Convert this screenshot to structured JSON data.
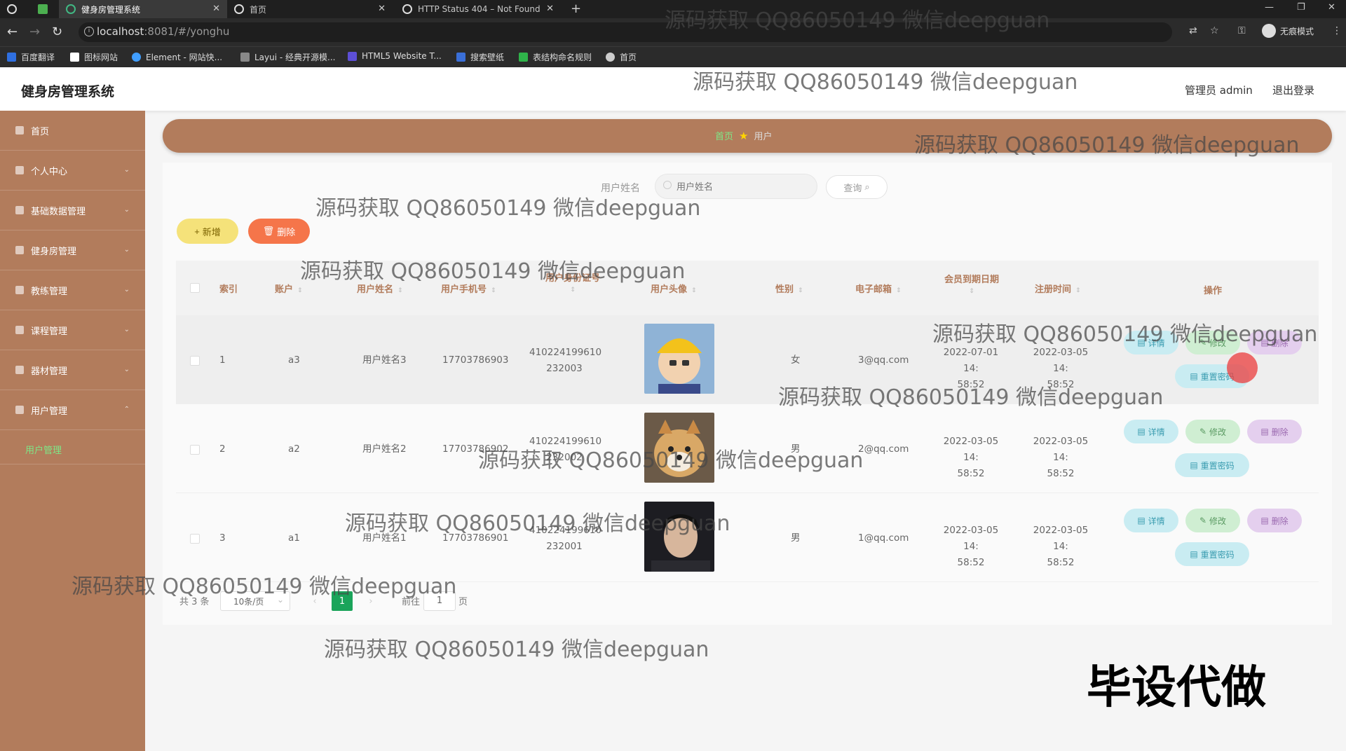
{
  "browser": {
    "tabs": [
      "健身房管理系统",
      "首页",
      "HTTP Status 404 – Not Found"
    ],
    "url_host": "localhost",
    "url_path": ":8081/#/yonghu",
    "profile": "无痕模式",
    "bookmarks": [
      "百度翻译",
      "图标网站",
      "Element - 网站快...",
      "Layui - 经典开源模...",
      "HTML5 Website T...",
      "搜索壁纸",
      "表结构命名规则",
      "首页"
    ]
  },
  "header": {
    "title": "健身房管理系统",
    "user": "管理员 admin",
    "logout": "退出登录"
  },
  "sidebar": {
    "items": [
      "首页",
      "个人中心",
      "基础数据管理",
      "健身房管理",
      "教练管理",
      "课程管理",
      "器材管理",
      "用户管理"
    ],
    "sub_item": "用户管理"
  },
  "breadcrumb": {
    "home": "首页",
    "current": "用户"
  },
  "search": {
    "label": "用户姓名",
    "placeholder": "用户姓名",
    "button": "查询"
  },
  "actions": {
    "add": "新增",
    "delete": "删除"
  },
  "table": {
    "columns": [
      "索引",
      "账户",
      "用户姓名",
      "用户手机号",
      "用户身份证号",
      "用户头像",
      "性别",
      "电子邮箱",
      "会员到期日期",
      "注册时间",
      "操作"
    ],
    "row_actions": {
      "detail": "详情",
      "edit": "修改",
      "delete": "删除",
      "reset": "重置密码"
    },
    "rows": [
      {
        "index": "1",
        "account": "a3",
        "name": "用户姓名3",
        "phone": "17703786903",
        "id1": "410224199610",
        "id2": "232003",
        "gender": "女",
        "email": "3@qq.com",
        "exp1": "2022-07-01 14:",
        "exp2": "58:52",
        "reg1": "2022-03-05 14:",
        "reg2": "58:52"
      },
      {
        "index": "2",
        "account": "a2",
        "name": "用户姓名2",
        "phone": "17703786902",
        "id1": "410224199610",
        "id2": "232002",
        "gender": "男",
        "email": "2@qq.com",
        "exp1": "2022-03-05 14:",
        "exp2": "58:52",
        "reg1": "2022-03-05 14:",
        "reg2": "58:52"
      },
      {
        "index": "3",
        "account": "a1",
        "name": "用户姓名1",
        "phone": "17703786901",
        "id1": "410224199610",
        "id2": "232001",
        "gender": "男",
        "email": "1@qq.com",
        "exp1": "2022-03-05 14:",
        "exp2": "58:52",
        "reg1": "2022-03-05 14:",
        "reg2": "58:52"
      }
    ]
  },
  "pagination": {
    "total": "共 3 条",
    "page_size": "10条/页",
    "current": "1",
    "goto": "前往",
    "goto_value": "1",
    "page_unit": "页"
  },
  "watermarks": {
    "text": "源码获取 QQ86050149 微信deepguan",
    "stamp": "毕设代做"
  },
  "colors": {
    "sidebar": "#b27c5c",
    "accent_green": "#7ee787",
    "add_button": "#f5e27a",
    "delete_button": "#f5754a"
  }
}
